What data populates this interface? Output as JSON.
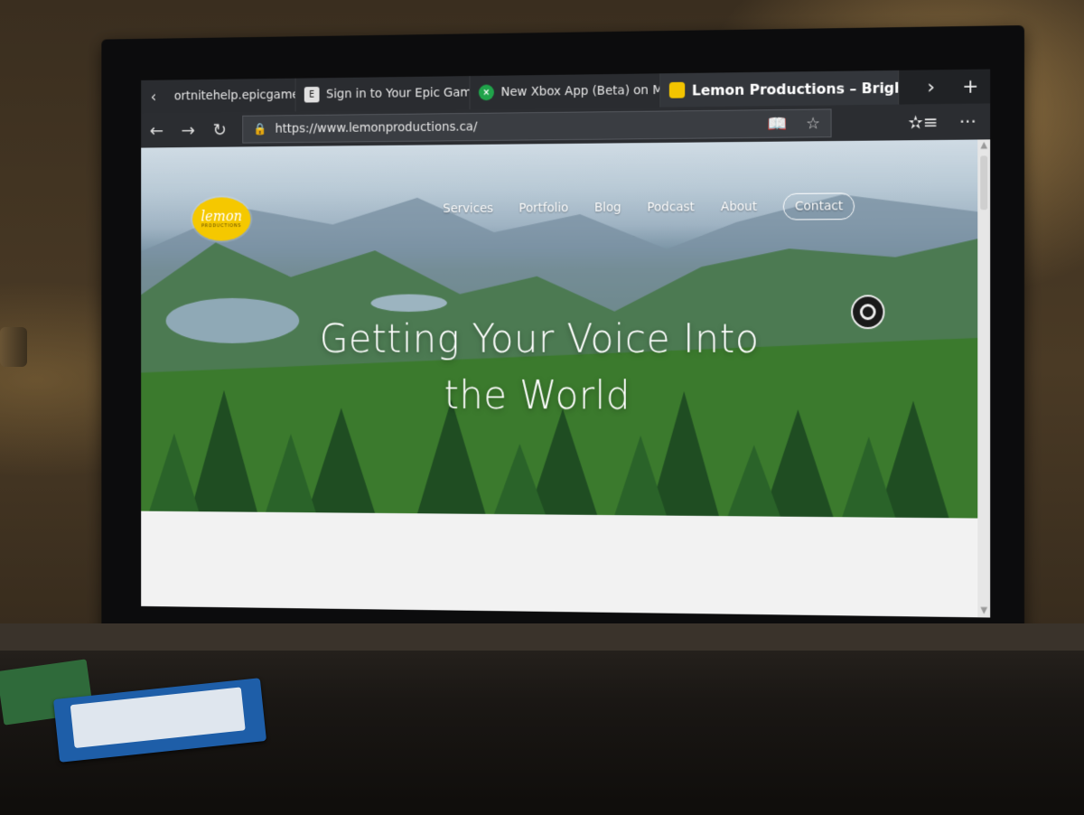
{
  "browser": {
    "tabs": [
      {
        "label": "ortnitehelp.epicgames.com",
        "icon": "none",
        "active": false
      },
      {
        "label": "Sign in to Your Epic Games .",
        "icon": "epic-games-icon",
        "active": false
      },
      {
        "label": "New Xbox App (Beta) on M",
        "icon": "xbox-icon",
        "active": false
      },
      {
        "label": "Lemon Productions – Bright",
        "icon": "lemon-icon",
        "active": true
      }
    ],
    "tab_scroll_left": "‹",
    "tab_scroll_right": "›",
    "new_tab": "+",
    "back": "←",
    "forward": "→",
    "refresh": "↻",
    "url": "https://www.lemonproductions.ca/",
    "lock": "🔒",
    "reading_view": "📖",
    "favorite": "☆",
    "favorites_bar": "✫≡",
    "more": "···"
  },
  "site": {
    "logo_text": "lemon",
    "logo_sub": "PRODUCTIONS",
    "nav": [
      "Services",
      "Portfolio",
      "Blog",
      "Podcast",
      "About"
    ],
    "contact": "Contact",
    "hero_line1": "Getting Your Voice Into",
    "hero_line2": "the World"
  },
  "colors": {
    "accent_lemon": "#f5c800",
    "xbox_green": "#20a34a",
    "browser_chrome": "#202225"
  }
}
